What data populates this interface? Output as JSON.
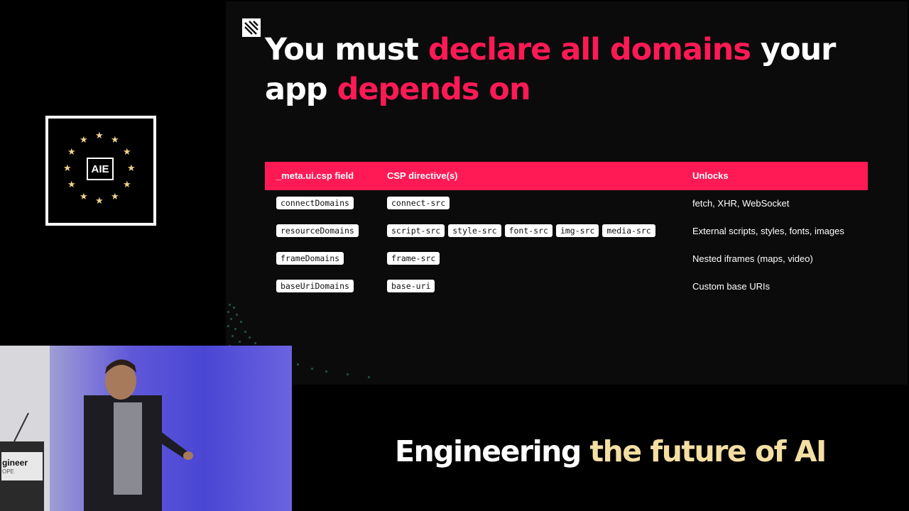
{
  "slide": {
    "title_part1": "You must ",
    "title_highlight1": "declare all domains",
    "title_part2": " your app ",
    "title_highlight2": "depends on",
    "accent_color": "#ff1a55",
    "table": {
      "headers": [
        "_meta.ui.csp field",
        "CSP directive(s)",
        "Unlocks"
      ],
      "rows": [
        {
          "field": "connectDomains",
          "directives": [
            "connect-src"
          ],
          "unlocks": "fetch, XHR, WebSocket"
        },
        {
          "field": "resourceDomains",
          "directives": [
            "script-src",
            "style-src",
            "font-src",
            "img-src",
            "media-src"
          ],
          "unlocks": "External scripts, styles, fonts, images"
        },
        {
          "field": "frameDomains",
          "directives": [
            "frame-src"
          ],
          "unlocks": "Nested iframes (maps, video)"
        },
        {
          "field": "baseUriDomains",
          "directives": [
            "base-uri"
          ],
          "unlocks": "Custom base URIs"
        }
      ]
    }
  },
  "badge": {
    "label": "AIE",
    "star_color": "#f2d38a"
  },
  "video": {
    "podium_text": "gineer",
    "podium_sub": "OPE"
  },
  "tagline": {
    "part1": "Engineering ",
    "part2": "the future of AI",
    "gold_color": "#f4dea2"
  }
}
